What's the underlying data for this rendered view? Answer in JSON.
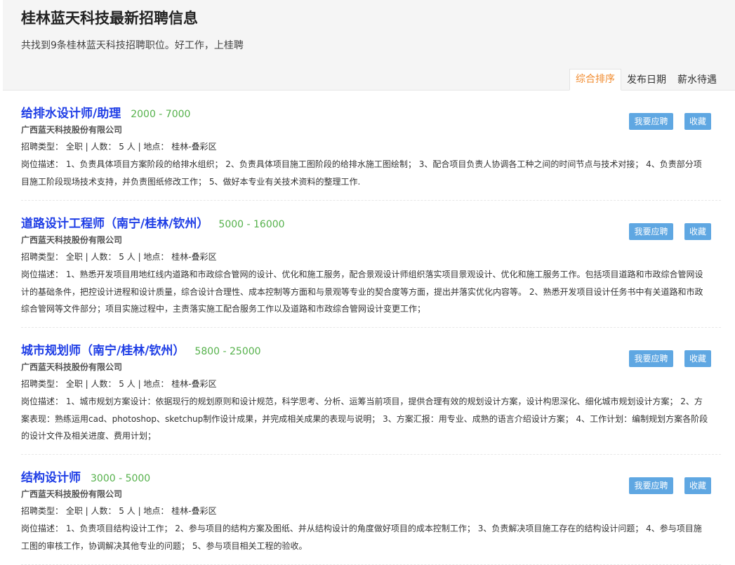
{
  "header": {
    "title": "桂林蓝天科技最新招聘信息",
    "subtitle": "共找到9条桂林蓝天科技招聘职位。好工作，上桂聘"
  },
  "sort_tabs": [
    {
      "label": "综合排序",
      "active": true
    },
    {
      "label": "发布日期",
      "active": false
    },
    {
      "label": "薪水待遇",
      "active": false
    }
  ],
  "buttons": {
    "apply": "我要应聘",
    "favorite": "收藏"
  },
  "jobs": [
    {
      "title": "给排水设计师/助理",
      "salary": "2000 - 7000",
      "company": "广西蓝天科技股份有限公司",
      "meta": "招聘类型： 全职 | 人数： 5 人 | 地点： 桂林-叠彩区",
      "description": "岗位描述： 1、负责具体项目方案阶段的给排水组织； 2、负责具体项目施工图阶段的给排水施工图绘制； 3、配合项目负责人协调各工种之间的时间节点与技术对接； 4、负责部分项目施工阶段现场技术支持，并负责图纸修改工作； 5、做好本专业有关技术资料的整理工作."
    },
    {
      "title": "道路设计工程师（南宁/桂林/钦州）",
      "salary": "5000 - 16000",
      "company": "广西蓝天科技股份有限公司",
      "meta": "招聘类型： 全职 | 人数： 5 人 | 地点： 桂林-叠彩区",
      "description": "岗位描述： 1、熟悉开发项目用地红线内道路和市政综合管网的设计、优化和施工服务，配合景观设计师组织落实项目景观设计、优化和施工服务工作。包括项目道路和市政综合管网设计的基础条件，把控设计进程和设计质量，综合设计合理性、成本控制等方面和与景观等专业的契合度等方面，提出并落实优化内容等。 2、熟悉开发项目设计任务书中有关道路和市政综合管网等文件部分；项目实施过程中，主责落实施工配合服务工作以及道路和市政综合管网设计变更工作；"
    },
    {
      "title": "城市规划师（南宁/桂林/钦州）",
      "salary": "5800 - 25000",
      "company": "广西蓝天科技股份有限公司",
      "meta": "招聘类型： 全职 | 人数： 5 人 | 地点： 桂林-叠彩区",
      "description": "岗位描述： 1、城市规划方案设计：依据现行的规划原则和设计规范，科学思考、分析、运筹当前项目，提供合理有效的规划设计方案，设计构思深化、细化城市规划设计方案； 2、方案表现：熟练运用cad、photoshop、sketchup制作设计成果，并完成相关成果的表现与说明； 3、方案汇报：用专业、成熟的语言介绍设计方案； 4、工作计划：编制规划方案各阶段的设计文件及相关进度、费用计划；"
    },
    {
      "title": "结构设计师",
      "salary": "3000 - 5000",
      "company": "广西蓝天科技股份有限公司",
      "meta": "招聘类型： 全职 | 人数： 5 人 | 地点： 桂林-叠彩区",
      "description": "岗位描述： 1、负责项目结构设计工作； 2、参与项目的结构方案及图纸、并从结构设计的角度做好项目的成本控制工作； 3、负责解决项目施工存在的结构设计问题； 4、参与项目施工图的审核工作，协调解决其他专业的问题； 5、参与项目相关工程的验收。"
    }
  ]
}
